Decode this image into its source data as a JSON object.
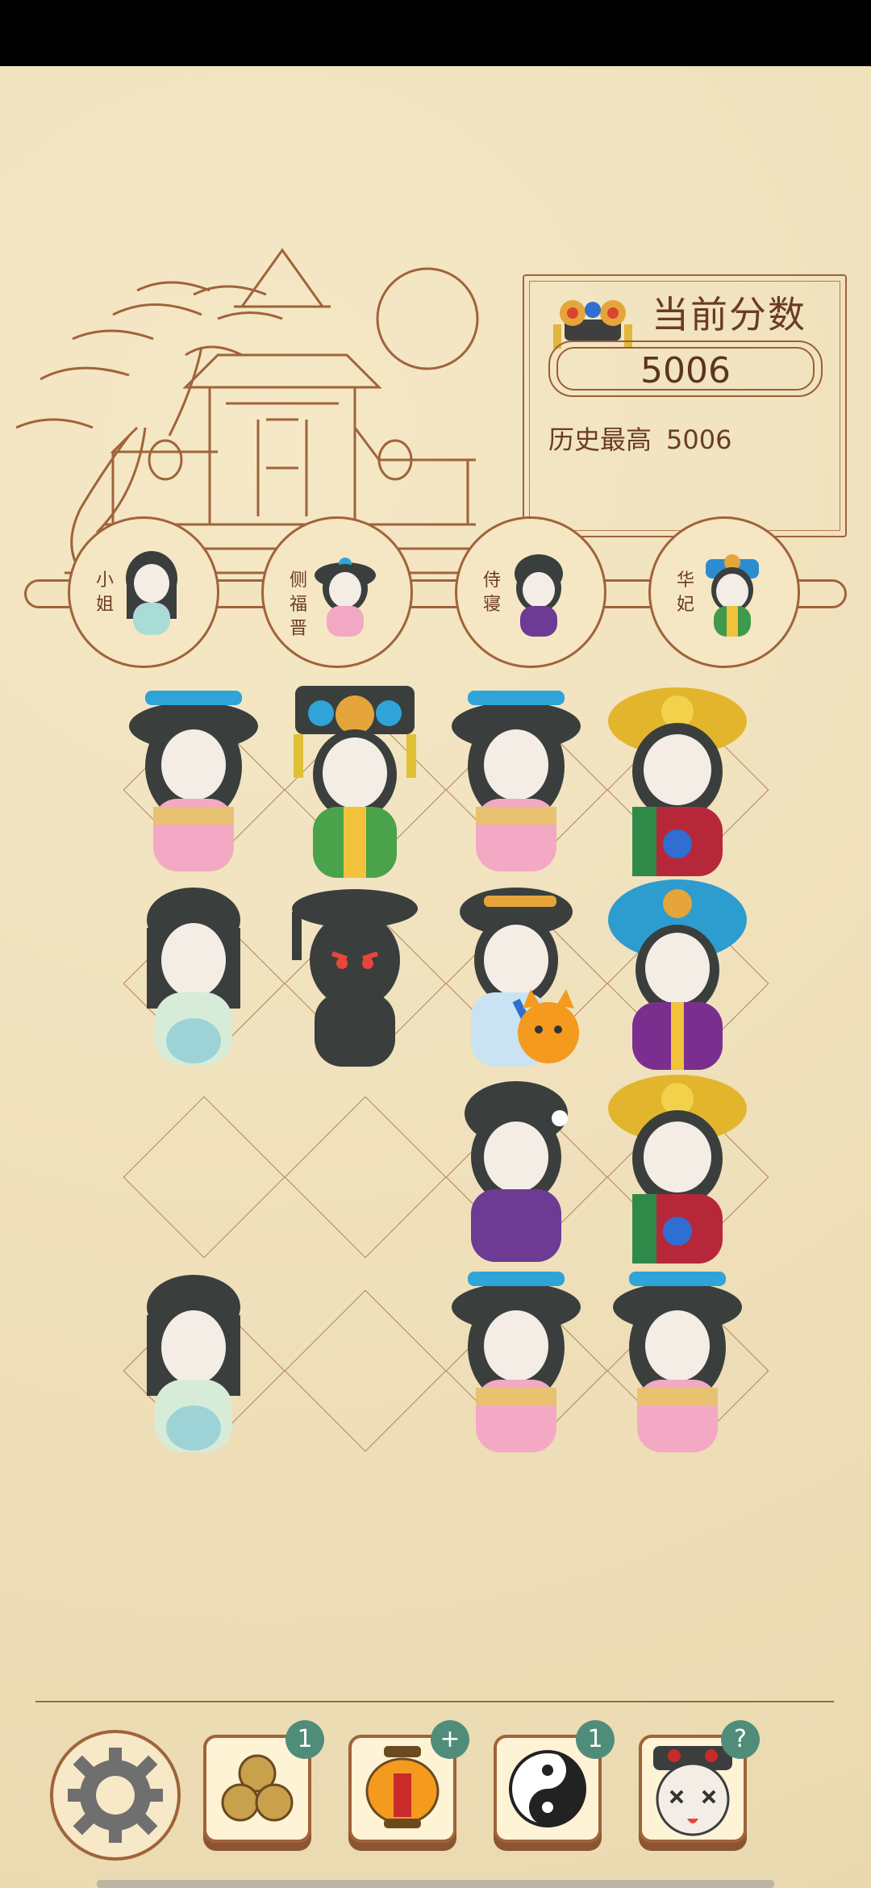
{
  "score": {
    "title": "当前分数",
    "value": "5006",
    "best_label": "历史最高",
    "best_value": "5006"
  },
  "ranks": [
    {
      "label": "小姐",
      "icon": "miss-doll-icon"
    },
    {
      "label": "侧福晋",
      "icon": "side-consort-doll-icon"
    },
    {
      "label": "侍寝",
      "icon": "attendant-doll-icon"
    },
    {
      "label": "华妃",
      "icon": "consort-hua-doll-icon"
    }
  ],
  "board": [
    [
      "pink-lady",
      "green-consort",
      "pink-lady",
      "red-empress"
    ],
    [
      "mint-lady",
      "shadow-enemy",
      "blue-cat-lady",
      "purple-phoenix"
    ],
    [
      "empty",
      "empty",
      "purple-lady",
      "red-empress"
    ],
    [
      "mint-lady",
      "empty",
      "pink-lady",
      "pink-lady"
    ]
  ],
  "tools": [
    {
      "name": "settings-gear-icon",
      "badge": ""
    },
    {
      "name": "beads-icon",
      "badge": "1"
    },
    {
      "name": "lantern-icon",
      "badge": "+"
    },
    {
      "name": "yin-yang-icon",
      "badge": "1"
    },
    {
      "name": "help-doll-icon",
      "badge": "?"
    }
  ],
  "colors": {
    "accent": "#a0633a",
    "badge": "#4f8d7a",
    "paper": "#f1e3bf"
  }
}
